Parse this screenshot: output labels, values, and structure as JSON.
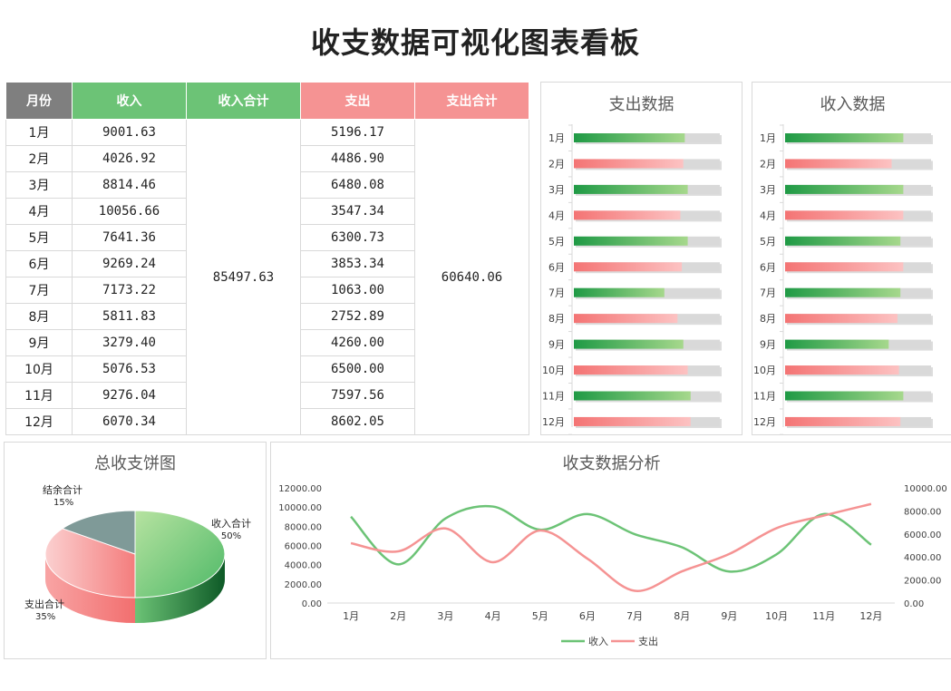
{
  "title": "收支数据可视化图表看板",
  "table": {
    "headers": [
      "月份",
      "收入",
      "收入合计",
      "支出",
      "支出合计"
    ],
    "income_total": "85497.63",
    "expense_total": "60640.06",
    "rows": [
      {
        "month": "1月",
        "income": "9001.63",
        "expense": "5196.17"
      },
      {
        "month": "2月",
        "income": "4026.92",
        "expense": "4486.90"
      },
      {
        "month": "3月",
        "income": "8814.46",
        "expense": "6480.08"
      },
      {
        "month": "4月",
        "income": "10056.66",
        "expense": "3547.34"
      },
      {
        "month": "5月",
        "income": "7641.36",
        "expense": "6300.73"
      },
      {
        "month": "6月",
        "income": "9269.24",
        "expense": "3853.34"
      },
      {
        "month": "7月",
        "income": "7173.22",
        "expense": "1063.00"
      },
      {
        "month": "8月",
        "income": "5811.83",
        "expense": "2752.89"
      },
      {
        "month": "9月",
        "income": "3279.40",
        "expense": "4260.00"
      },
      {
        "month": "10月",
        "income": "5076.53",
        "expense": "6500.00"
      },
      {
        "month": "11月",
        "income": "9276.04",
        "expense": "7597.56"
      },
      {
        "month": "12月",
        "income": "6070.34",
        "expense": "8602.05"
      }
    ]
  },
  "chart_data": [
    {
      "type": "bar",
      "title": "支出数据",
      "categories": [
        "1月",
        "2月",
        "3月",
        "4月",
        "5月",
        "6月",
        "7月",
        "8月",
        "9月",
        "10月",
        "11月",
        "12月"
      ],
      "values": [
        0.76,
        0.75,
        0.78,
        0.73,
        0.78,
        0.74,
        0.62,
        0.71,
        0.75,
        0.78,
        0.8,
        0.8
      ],
      "colors": [
        "#23a047",
        "#f47b7b"
      ]
    },
    {
      "type": "bar",
      "title": "收入数据",
      "categories": [
        "1月",
        "2月",
        "3月",
        "4月",
        "5月",
        "6月",
        "7月",
        "8月",
        "9月",
        "10月",
        "11月",
        "12月"
      ],
      "values": [
        0.81,
        0.73,
        0.81,
        0.81,
        0.79,
        0.81,
        0.79,
        0.77,
        0.71,
        0.78,
        0.81,
        0.79
      ],
      "colors": [
        "#23a047",
        "#f47b7b"
      ]
    },
    {
      "type": "pie",
      "title": "总收支饼图",
      "slices": [
        {
          "label": "收入合计",
          "pct": "50%",
          "value": 50,
          "color": "#6cc376"
        },
        {
          "label": "支出合计",
          "pct": "35%",
          "value": 35,
          "color": "#f59393"
        },
        {
          "label": "结余合计",
          "pct": "15%",
          "value": 15,
          "color": "#7f9a98"
        }
      ]
    },
    {
      "type": "line",
      "title": "收支数据分析",
      "categories": [
        "1月",
        "2月",
        "3月",
        "4月",
        "5月",
        "6月",
        "7月",
        "8月",
        "9月",
        "10月",
        "11月",
        "12月"
      ],
      "y_left": {
        "ticks": [
          "0.00",
          "2000.00",
          "4000.00",
          "6000.00",
          "8000.00",
          "10000.00",
          "12000.00"
        ],
        "ylim": [
          0,
          12000
        ]
      },
      "y_right": {
        "ticks": [
          "0.00",
          "2000.00",
          "4000.00",
          "6000.00",
          "8000.00",
          "10000.00"
        ],
        "ylim": [
          0,
          10000
        ]
      },
      "series": [
        {
          "name": "收入",
          "axis": "left",
          "color": "#6cc376",
          "values": [
            9001.63,
            4026.92,
            8814.46,
            10056.66,
            7641.36,
            9269.24,
            7173.22,
            5811.83,
            3279.4,
            5076.53,
            9276.04,
            6070.34
          ]
        },
        {
          "name": "支出",
          "axis": "right",
          "color": "#f59393",
          "values": [
            5196.17,
            4486.9,
            6480.08,
            3547.34,
            6300.73,
            3853.34,
            1063.0,
            2752.89,
            4260.0,
            6500.0,
            7597.56,
            8602.05
          ]
        }
      ]
    }
  ]
}
